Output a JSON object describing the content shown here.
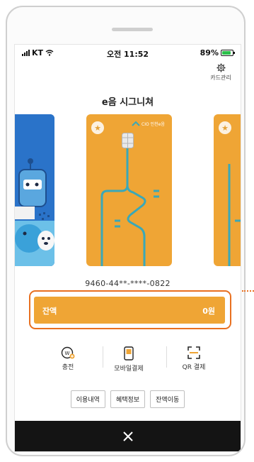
{
  "statusbar": {
    "carrier": "KT",
    "time": "오전 11:52",
    "battery": "89%"
  },
  "header": {
    "card_management_label": "카드관리",
    "title": "e음 시그니쳐"
  },
  "cards": {
    "center_logo_text": "CIO 인천e음",
    "number": "9460-44**-****-0822"
  },
  "balance": {
    "label": "잔액",
    "value": "0원"
  },
  "actions": [
    {
      "label": "충전",
      "icon": "charge-icon"
    },
    {
      "label": "모바일결제",
      "icon": "mobile-pay-icon"
    },
    {
      "label": "QR 결제",
      "icon": "qr-scan-icon"
    }
  ],
  "buttons": [
    "이용내역",
    "혜택정보",
    "잔액이동"
  ],
  "colors": {
    "card_orange": "#efa535",
    "card_teal_line": "#3aa8b8",
    "highlight_orange": "#e87020",
    "left_card_blue": "#2a73c9",
    "bottom_bar": "#141414"
  }
}
